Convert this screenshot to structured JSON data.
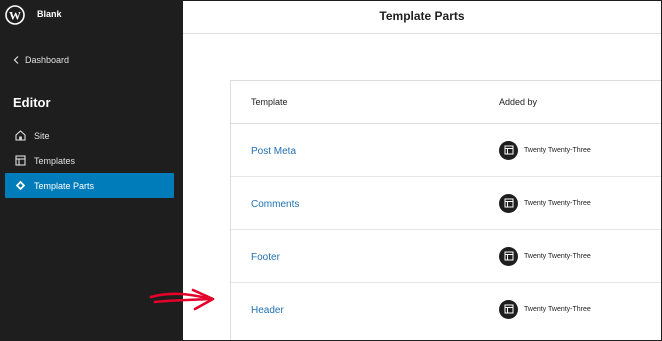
{
  "sidebar": {
    "site_name": "Blank",
    "back_label": "Dashboard",
    "heading": "Editor",
    "items": [
      {
        "label": "Site",
        "icon": "home-icon"
      },
      {
        "label": "Templates",
        "icon": "layout-icon"
      },
      {
        "label": "Template Parts",
        "icon": "symbol-icon",
        "active": true
      }
    ]
  },
  "main": {
    "title": "Template Parts",
    "table": {
      "columns": [
        "Template",
        "Added by"
      ],
      "rows": [
        {
          "template": "Post Meta",
          "added_by": "Twenty Twenty-Three"
        },
        {
          "template": "Comments",
          "added_by": "Twenty Twenty-Three"
        },
        {
          "template": "Footer",
          "added_by": "Twenty Twenty-Three"
        },
        {
          "template": "Header",
          "added_by": "Twenty Twenty-Three"
        }
      ]
    }
  },
  "colors": {
    "sidebar_bg": "#1e1e1e",
    "accent": "#007cba",
    "link": "#2271b1",
    "annotation": "#e4002b"
  }
}
